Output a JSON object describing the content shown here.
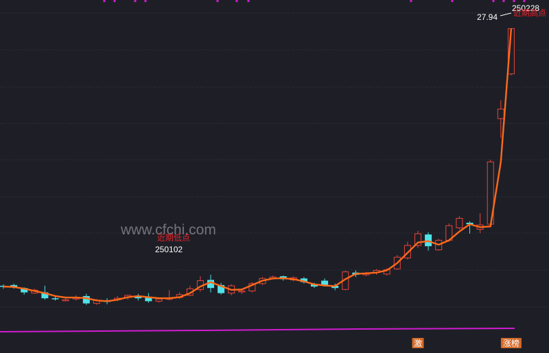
{
  "watermark": "www.cfchi.com",
  "colors": {
    "background": "#1e1f26",
    "grid": "#3a3d4a",
    "up": "#e8453c",
    "down": "#4fe3e8",
    "ma": "#ff6a1a",
    "volume_line": "#d21bd2",
    "top_markers": "#d21bd2",
    "annotation_red": "#e8232c",
    "annotation_white": "#ffffff",
    "tag_bg": "#d46a2a"
  },
  "annotations": {
    "low_label": "近期低点",
    "low_date": "250102",
    "high_label": "近期高点",
    "high_date": "250228",
    "high_value": "27.94"
  },
  "tags": [
    {
      "text": "激",
      "index": 40
    },
    {
      "text": "涨榜",
      "index": 49
    }
  ],
  "chart_data": {
    "type": "candlestick",
    "title": "",
    "ylim": [
      7.5,
      29.0
    ],
    "candles": [
      {
        "o": 10.4,
        "c": 10.35,
        "h": 10.5,
        "l": 10.2
      },
      {
        "o": 10.45,
        "c": 10.3,
        "h": 10.55,
        "l": 10.2
      },
      {
        "o": 10.25,
        "c": 9.95,
        "h": 10.3,
        "l": 9.8
      },
      {
        "o": 9.9,
        "c": 10.1,
        "h": 10.2,
        "l": 9.85
      },
      {
        "o": 9.95,
        "c": 9.55,
        "h": 10.4,
        "l": 9.45
      },
      {
        "o": 9.55,
        "c": 9.5,
        "h": 9.7,
        "l": 9.4
      },
      {
        "o": 9.45,
        "c": 9.45,
        "h": 9.6,
        "l": 9.35
      },
      {
        "o": 9.5,
        "c": 9.6,
        "h": 9.75,
        "l": 9.4
      },
      {
        "o": 9.7,
        "c": 9.2,
        "h": 9.85,
        "l": 9.1
      },
      {
        "o": 9.2,
        "c": 9.4,
        "h": 9.5,
        "l": 9.1
      },
      {
        "o": 9.4,
        "c": 9.3,
        "h": 9.55,
        "l": 9.15
      },
      {
        "o": 9.45,
        "c": 9.55,
        "h": 9.7,
        "l": 9.35
      },
      {
        "o": 9.6,
        "c": 9.75,
        "h": 9.8,
        "l": 9.45
      },
      {
        "o": 9.7,
        "c": 9.55,
        "h": 9.85,
        "l": 9.4
      },
      {
        "o": 9.6,
        "c": 9.35,
        "h": 9.9,
        "l": 9.25
      },
      {
        "o": 9.35,
        "c": 9.5,
        "h": 9.6,
        "l": 9.25
      },
      {
        "o": 9.5,
        "c": 9.55,
        "h": 10.1,
        "l": 9.4
      },
      {
        "o": 9.6,
        "c": 9.8,
        "h": 9.95,
        "l": 9.5
      },
      {
        "o": 9.75,
        "c": 10.2,
        "h": 10.4,
        "l": 9.7
      },
      {
        "o": 10.15,
        "c": 10.75,
        "h": 11.05,
        "l": 10.0
      },
      {
        "o": 10.8,
        "c": 10.25,
        "h": 11.15,
        "l": 9.95
      },
      {
        "o": 10.45,
        "c": 9.9,
        "h": 10.6,
        "l": 9.8
      },
      {
        "o": 9.9,
        "c": 10.4,
        "h": 10.5,
        "l": 9.75
      },
      {
        "o": 10.0,
        "c": 10.05,
        "h": 10.2,
        "l": 9.85
      },
      {
        "o": 10.05,
        "c": 10.55,
        "h": 10.65,
        "l": 9.95
      },
      {
        "o": 10.55,
        "c": 10.9,
        "h": 11.0,
        "l": 10.45
      },
      {
        "o": 10.9,
        "c": 11.0,
        "h": 11.1,
        "l": 10.85
      },
      {
        "o": 11.05,
        "c": 10.85,
        "h": 11.1,
        "l": 10.75
      },
      {
        "o": 10.8,
        "c": 10.95,
        "h": 11.05,
        "l": 10.7
      },
      {
        "o": 10.9,
        "c": 10.65,
        "h": 11.0,
        "l": 10.55
      },
      {
        "o": 10.5,
        "c": 10.35,
        "h": 10.6,
        "l": 10.25
      },
      {
        "o": 10.75,
        "c": 10.45,
        "h": 10.9,
        "l": 10.35
      },
      {
        "o": 10.4,
        "c": 10.25,
        "h": 10.55,
        "l": 10.1
      },
      {
        "o": 10.15,
        "c": 11.35,
        "h": 11.45,
        "l": 10.1
      },
      {
        "o": 11.3,
        "c": 11.15,
        "h": 11.45,
        "l": 11.0
      },
      {
        "o": 11.15,
        "c": 11.25,
        "h": 11.35,
        "l": 11.05
      },
      {
        "o": 11.3,
        "c": 11.45,
        "h": 11.55,
        "l": 11.15
      },
      {
        "o": 11.2,
        "c": 11.5,
        "h": 11.6,
        "l": 11.1
      },
      {
        "o": 11.55,
        "c": 12.35,
        "h": 12.5,
        "l": 11.5
      },
      {
        "o": 12.3,
        "c": 13.15,
        "h": 13.4,
        "l": 12.2
      },
      {
        "o": 13.15,
        "c": 13.95,
        "h": 14.15,
        "l": 13.0
      },
      {
        "o": 13.9,
        "c": 13.1,
        "h": 14.05,
        "l": 12.8
      },
      {
        "o": 12.85,
        "c": 13.5,
        "h": 13.6,
        "l": 12.8
      },
      {
        "o": 13.5,
        "c": 14.5,
        "h": 14.65,
        "l": 13.4
      },
      {
        "o": 14.35,
        "c": 15.0,
        "h": 15.15,
        "l": 14.25
      },
      {
        "o": 14.7,
        "c": 14.6,
        "h": 14.8,
        "l": 13.95
      },
      {
        "o": 14.25,
        "c": 14.55,
        "h": 15.35,
        "l": 14.0
      },
      {
        "o": 14.6,
        "c": 18.85,
        "h": 19.0,
        "l": 14.55
      },
      {
        "o": 21.8,
        "c": 22.45,
        "h": 23.05,
        "l": 20.5
      },
      {
        "o": 24.85,
        "c": 27.94,
        "h": 27.94,
        "l": 24.75
      }
    ],
    "ma": [
      10.35,
      10.32,
      10.2,
      10.05,
      9.9,
      9.7,
      9.6,
      9.6,
      9.55,
      9.4,
      9.35,
      9.45,
      9.62,
      9.7,
      9.62,
      9.55,
      9.55,
      9.62,
      9.9,
      10.35,
      10.65,
      10.38,
      10.12,
      10.15,
      10.45,
      10.75,
      10.9,
      10.92,
      10.85,
      10.7,
      10.5,
      10.42,
      10.38,
      10.85,
      11.22,
      11.25,
      11.3,
      11.45,
      11.95,
      12.65,
      13.35,
      13.45,
      13.2,
      13.5,
      14.1,
      14.6,
      14.4,
      14.45,
      18.85,
      27.94
    ]
  }
}
